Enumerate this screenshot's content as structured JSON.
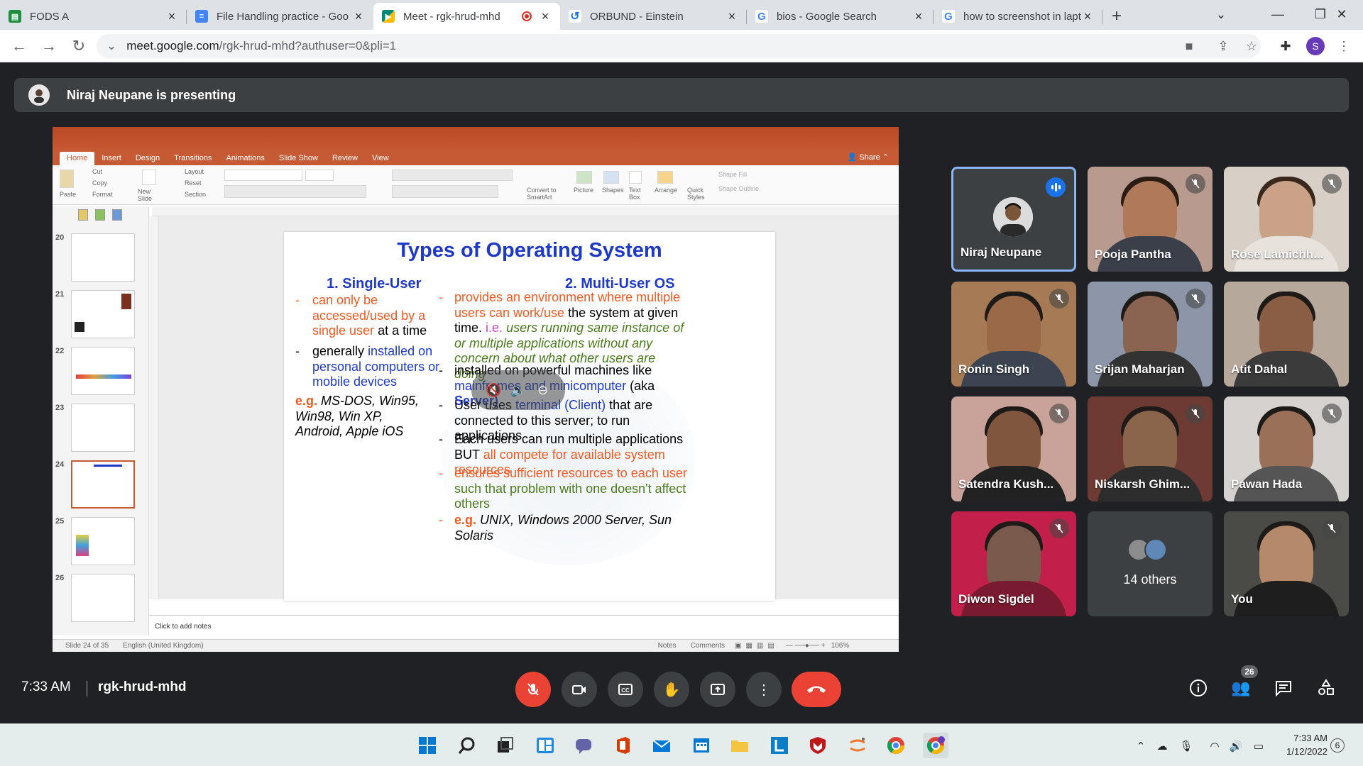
{
  "browser": {
    "tabs": [
      {
        "label": "FODS A",
        "icon": "google-classroom-icon",
        "color": "#1e8e3e"
      },
      {
        "label": "File Handling practice - Goo",
        "icon": "google-docs-icon",
        "color": "#4285f4"
      },
      {
        "label": "Meet - rgk-hrud-mhd",
        "icon": "google-meet-icon",
        "color": "#00897b",
        "active": true
      },
      {
        "label": "ORBUND - Einstein",
        "icon": "orbund-icon",
        "color": "#1a73e8"
      },
      {
        "label": "bios - Google Search",
        "icon": "google-icon",
        "color": "#4285f4"
      },
      {
        "label": "how to screenshot in laptop",
        "icon": "google-icon",
        "color": "#4285f4"
      }
    ],
    "url_host": "meet.google.com",
    "url_path": "/rgk-hrud-mhd?authuser=0&pli=1",
    "profile_initial": "S"
  },
  "meet": {
    "presenting_banner": "Niraj Neupane is presenting",
    "clock": "7:33 AM",
    "meeting_code": "rgk-hrud-mhd",
    "participant_count": "26",
    "participants": [
      {
        "name": "Niraj Neupane",
        "speaking": true
      },
      {
        "name": "Pooja Pantha",
        "muted": true
      },
      {
        "name": "Rose Lamichh...",
        "muted": true
      },
      {
        "name": "Ronin Singh",
        "muted": true
      },
      {
        "name": "Srijan Maharjan",
        "muted": true
      },
      {
        "name": "Atit Dahal"
      },
      {
        "name": "Satendra Kush...",
        "muted": true
      },
      {
        "name": "Niskarsh Ghim...",
        "muted": true
      },
      {
        "name": "Pawan Hada",
        "muted": true
      },
      {
        "name": "Diwon Sigdel",
        "muted": true
      },
      {
        "name": "14 others"
      },
      {
        "name": "You",
        "muted": true
      }
    ]
  },
  "powerpoint": {
    "tabs": [
      "Home",
      "Insert",
      "Design",
      "Transitions",
      "Animations",
      "Slide Show",
      "Review",
      "View"
    ],
    "share": "Share",
    "ribbon": {
      "paste": "Paste",
      "cut": "Cut",
      "copy": "Copy",
      "format": "Format",
      "new_slide": "New Slide",
      "layout": "Layout",
      "reset": "Reset",
      "section": "Section",
      "convert": "Convert to SmartArt",
      "picture": "Picture",
      "shapes": "Shapes",
      "textbox": "Text Box",
      "arrange": "Arrange",
      "quick_styles": "Quick Styles",
      "shape_fill": "Shape Fill",
      "shape_outline": "Shape Outline"
    },
    "thumb_numbers": [
      "20",
      "21",
      "22",
      "23",
      "24",
      "25",
      "26"
    ],
    "notes_placeholder": "Click to add notes",
    "status": {
      "slide": "Slide 24 of 35",
      "language": "English (United Kingdom)",
      "notes": "Notes",
      "comments": "Comments",
      "zoom": "106%"
    }
  },
  "slide": {
    "title": "Types of Operating System",
    "col1_heading": "1. Single-User",
    "col2_heading": "2. Multi-User OS",
    "col1_b1": "can only be accessed/used by a single user",
    "col1_b1_tail": "at a time",
    "col1_b2_a": "generally",
    "col1_b2_b": "installed on personal computers or mobile devices",
    "col1_eg_label": "e.g.",
    "col1_eg": "MS-DOS, Win95, Win98, Win XP, Android, Apple iOS",
    "col2_b1_a": "provides an environment where multiple users can work/use",
    "col2_b1_b": "the system at given time.",
    "col2_b1_c": "i.e.",
    "col2_b1_d": "users running same instance of or multiple applications without any concern about what other users are doing",
    "col2_b2_a": "installed on powerful machines like",
    "col2_b2_b": "mainframes and minicomputer",
    "col2_b2_c": "(aka",
    "col2_b2_d": "Server)",
    "col2_b3_a": "User uses",
    "col2_b3_b": "terminal (Client)",
    "col2_b3_c": "that are connected to this server; to run applications",
    "col2_b4_a": "Each users can run multiple applications BUT",
    "col2_b4_b": "all compete for available system resources",
    "col2_b5_a": "ensures sufficient resources to each user",
    "col2_b5_b": "such that problem with one doesn't affect others",
    "col2_eg_label": "e.g.",
    "col2_eg": "UNIX, Windows 2000 Server, Sun Solaris"
  },
  "taskbar": {
    "time": "7:33 AM",
    "date": "1/12/2022",
    "notifications": "6"
  }
}
